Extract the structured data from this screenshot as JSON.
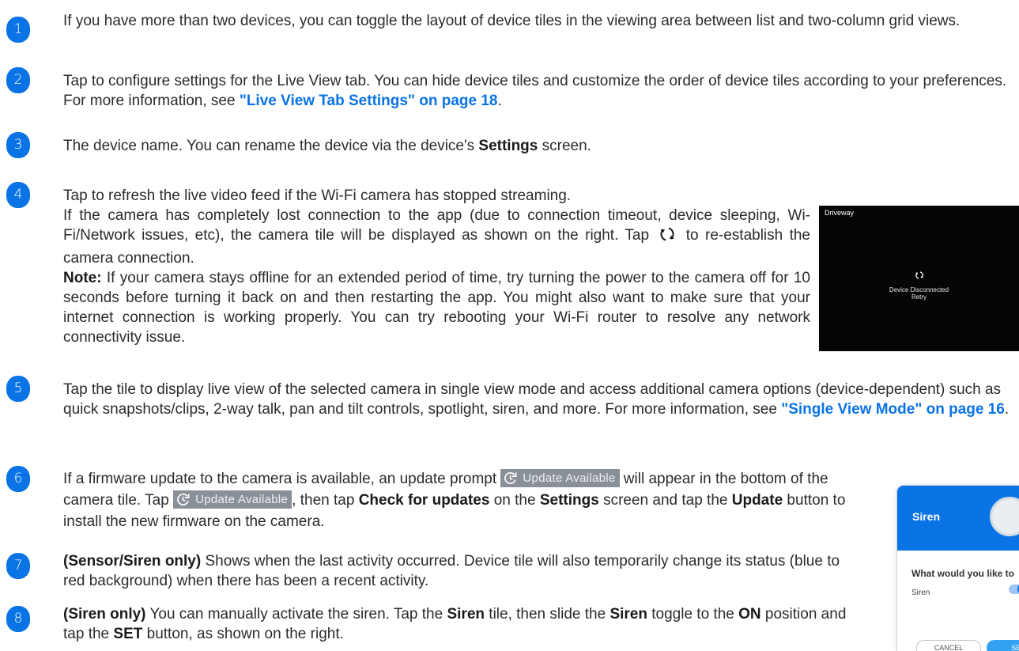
{
  "badges": [
    "1",
    "2",
    "3",
    "4",
    "5",
    "6",
    "7",
    "8"
  ],
  "item1": {
    "text": "If you have more than two devices, you can toggle the layout of device tiles in the viewing area between list and two-column grid views."
  },
  "item2": {
    "text": "Tap to configure settings for the Live View tab. You can hide device tiles and customize the order of device tiles according to your preferences. For more information, see ",
    "link": "\"Live View Tab Settings\" on page 18",
    "end": "."
  },
  "item3": {
    "text": "The device name. You can rename the device via the device's ",
    "bold": "Settings",
    "end": " screen."
  },
  "item4": {
    "line1": "Tap to refresh the live video feed if the Wi-Fi camera has stopped streaming.",
    "p2a": "If the camera has completely lost connection to the app (due to connection timeout, device sleeping, Wi-Fi/Network issues, etc), the camera tile will be displayed as shown on the right. Tap ",
    "p2b": " to re-establish the camera connection.",
    "note_label": "Note:",
    "note_text": " If your camera stays offline for an extended period of time, try turning the power to the camera off for 10 seconds before turning it back on and then restarting the app. You might also want to make sure that your internet connection is working properly. You can try rebooting your Wi-Fi router to resolve any network connectivity issue."
  },
  "item5": {
    "text": "Tap the tile to display live view of the selected camera in single view mode and access additional camera options (device-dependent) such as quick snapshots/clips, 2-way talk, pan and tilt controls, spotlight, siren, and more. For more information, see ",
    "link": "\"Single View Mode\" on page 16",
    "end": "."
  },
  "item6": {
    "a": "If a firmware update to the camera is available, an update prompt ",
    "pill": "Update Available",
    "b": " will appear in the bottom of the camera tile. Tap ",
    "c": ", then tap ",
    "bold1": "Check for updates",
    "d": " on the ",
    "bold2": "Settings",
    "e": " screen and tap the ",
    "bold3": "Update",
    "f": " button to install the new firmware on the camera."
  },
  "item7": {
    "bold": "(Sensor/Siren only)",
    "text": " Shows when the last activity occurred. Device tile will also temporarily change its status (blue to red background) when there has been a recent activity."
  },
  "item8": {
    "bold1": "(Siren only)",
    "a": " You can manually activate the siren. Tap the ",
    "bold2": "Siren",
    "b": " tile, then slide the ",
    "bold3": "Siren",
    "c": " toggle to the ",
    "bold4": "ON",
    "d": " position and tap the ",
    "bold5": "SET",
    "e": " button, as shown on the right."
  },
  "camera_tile": {
    "title": "Driveway",
    "status": "Device Disconnected",
    "retry": "Retry"
  },
  "siren_dialog": {
    "title": "Siren",
    "question": "What would you like to",
    "toggle_label": "Siren",
    "cancel": "CANCEL",
    "set": "SET"
  },
  "colors": {
    "accent": "#0a73e6",
    "pill_bg": "#8a9097"
  },
  "icons": [
    "refresh-icon",
    "update-icon",
    "siren-device-icon"
  ]
}
